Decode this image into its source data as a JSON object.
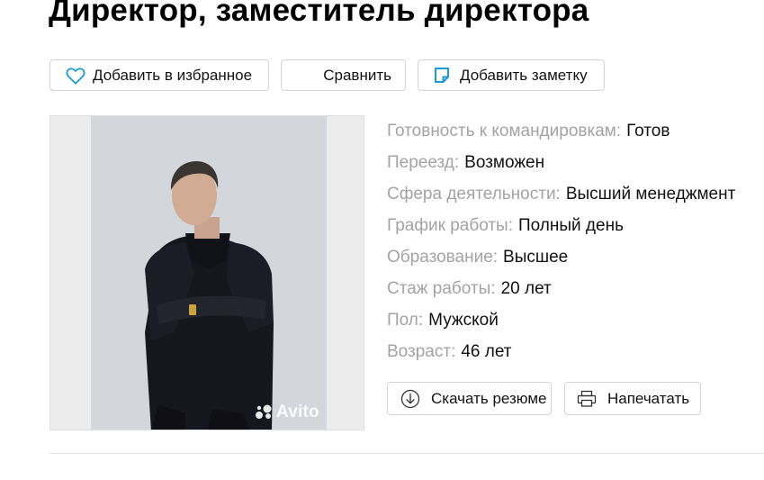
{
  "page": {
    "title": "Директор, заместитель директора"
  },
  "actions": {
    "favorite_label": "Добавить в избранное",
    "compare_label": "Сравнить",
    "note_label": "Добавить заметку",
    "download_label": "Скачать резюме",
    "print_label": "Напечатать"
  },
  "photo": {
    "watermark": "Avito"
  },
  "details": [
    {
      "key": "Готовность к командировкам:",
      "value": "Готов"
    },
    {
      "key": "Переезд:",
      "value": "Возможен"
    },
    {
      "key": "Сфера деятельности:",
      "value": "Высший менеджмент"
    },
    {
      "key": "График работы:",
      "value": "Полный день"
    },
    {
      "key": "Образование:",
      "value": "Высшее"
    },
    {
      "key": "Стаж работы:",
      "value": "20 лет"
    },
    {
      "key": "Пол:",
      "value": "Мужской"
    },
    {
      "key": "Возраст:",
      "value": "46 лет"
    }
  ],
  "icons": {
    "favorite": "heart-icon",
    "note": "note-icon",
    "download": "download-icon",
    "print": "printer-icon"
  },
  "colors": {
    "icon_accent": "#1a9ad6",
    "label_gray": "#a3a3a3",
    "border": "#d4d4d4"
  }
}
